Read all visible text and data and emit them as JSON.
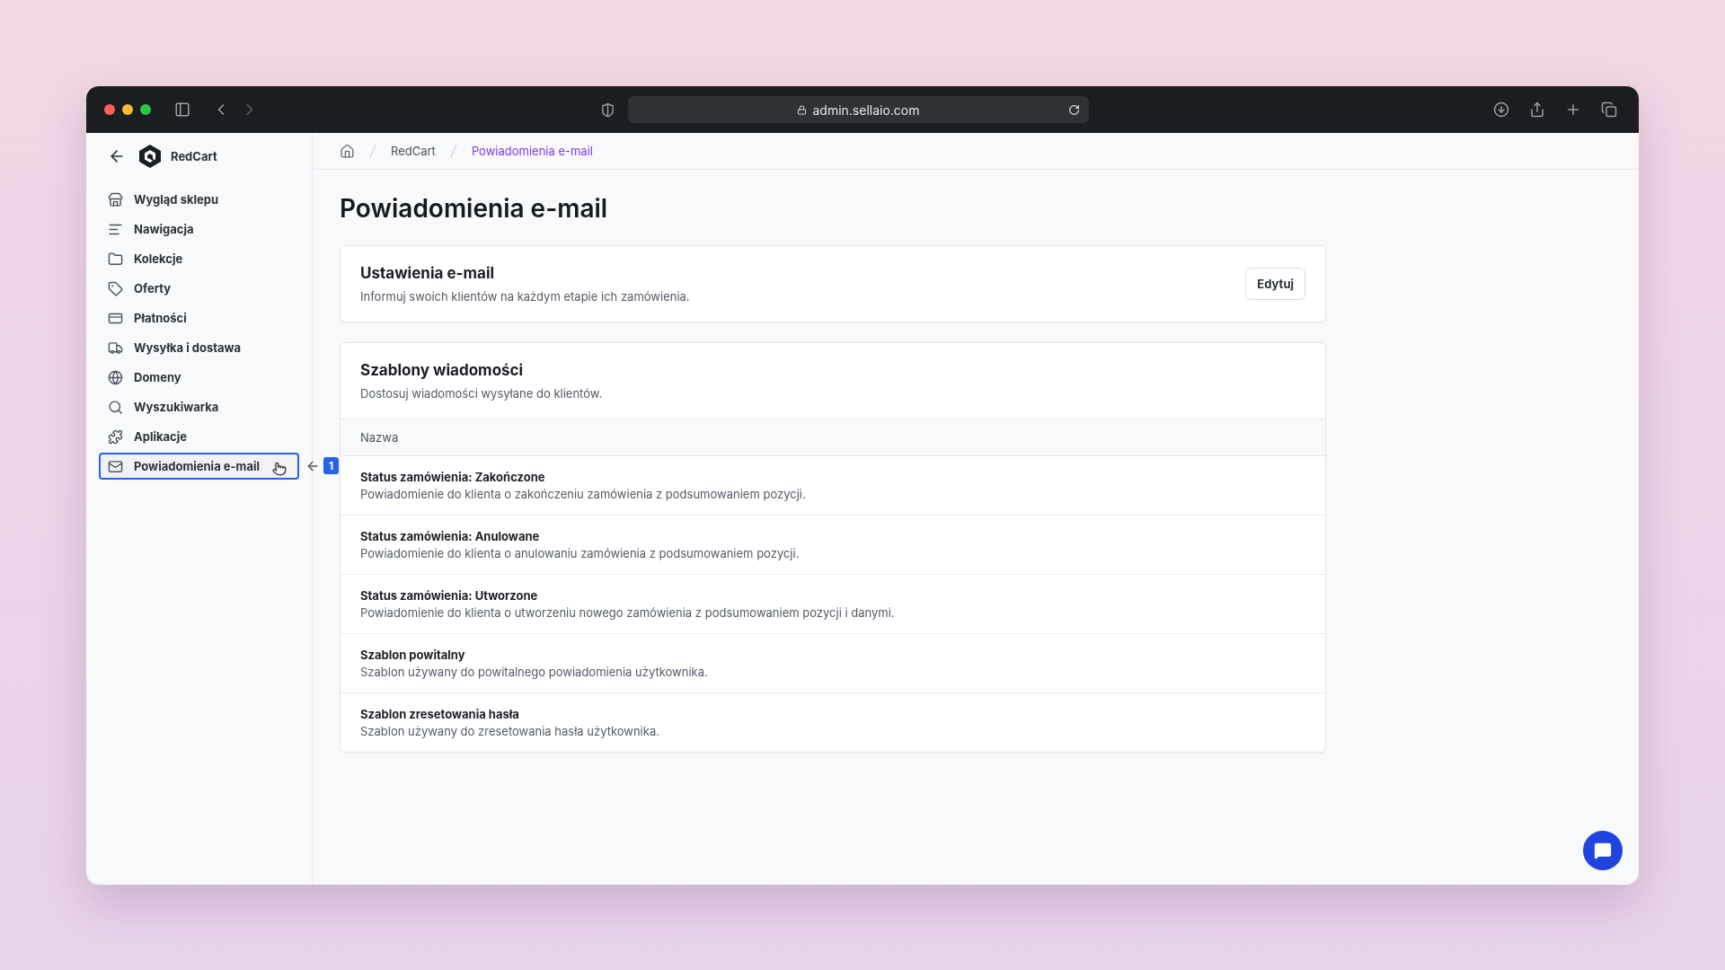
{
  "browser": {
    "url": "admin.sellaio.com"
  },
  "sidebar": {
    "back_label": "RedCart",
    "items": [
      {
        "label": "Wygląd sklepu",
        "selected": false
      },
      {
        "label": "Nawigacja",
        "selected": false
      },
      {
        "label": "Kolekcje",
        "selected": false
      },
      {
        "label": "Oferty",
        "selected": false
      },
      {
        "label": "Płatności",
        "selected": false
      },
      {
        "label": "Wysyłka i dostawa",
        "selected": false
      },
      {
        "label": "Domeny",
        "selected": false
      },
      {
        "label": "Wyszukiwarka",
        "selected": false
      },
      {
        "label": "Aplikacje",
        "selected": false
      },
      {
        "label": "Powiadomienia e-mail",
        "selected": true
      }
    ]
  },
  "annotation": {
    "badge": "1"
  },
  "breadcrumb": [
    "RedCart",
    "Powiadomienia e-mail"
  ],
  "page_title": "Powiadomienia e-mail",
  "settings_card": {
    "title": "Ustawienia e-mail",
    "description": "Informuj swoich klientów na każdym etapie ich zamówienia.",
    "button": "Edytuj"
  },
  "templates_card": {
    "title": "Szablony wiadomości",
    "description": "Dostosuj wiadomości wysyłane do klientów.",
    "column": "Nazwa",
    "rows": [
      {
        "title": "Status zamówienia: Zakończone",
        "description": "Powiadomienie do klienta o zakończeniu zamówienia z podsumowaniem pozycji."
      },
      {
        "title": "Status zamówienia: Anulowane",
        "description": "Powiadomienie do klienta o anulowaniu zamówienia z podsumowaniem pozycji."
      },
      {
        "title": "Status zamówienia: Utworzone",
        "description": "Powiadomienie do klienta o utworzeniu nowego zamówienia z podsumowaniem pozycji i danymi."
      },
      {
        "title": "Szablon powitalny",
        "description": "Szablon używany do powitalnego powiadomienia użytkownika."
      },
      {
        "title": "Szablon zresetowania hasła",
        "description": "Szablon używany do zresetowania hasła użytkownika."
      }
    ]
  }
}
